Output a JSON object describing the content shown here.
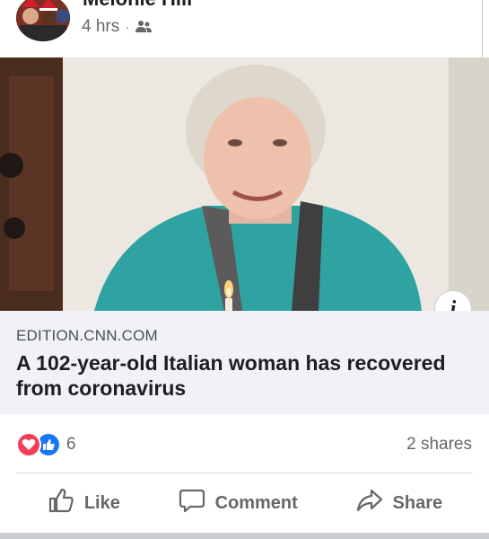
{
  "post": {
    "author": "Melonie Hill",
    "timestamp": "4 hrs",
    "separator": "·",
    "audience_icon": "friends-icon"
  },
  "link": {
    "domain": "EDITION.CNN.COM",
    "headline": "A 102-year-old Italian woman has recovered from coronavirus",
    "info_label": "i"
  },
  "reactions": {
    "icons": [
      "love-reaction-icon",
      "like-reaction-icon"
    ],
    "count": "6",
    "shares": "2 shares"
  },
  "actions": {
    "like": "Like",
    "comment": "Comment",
    "share": "Share"
  },
  "colors": {
    "love": "#f33e58",
    "like": "#1877f2",
    "secondary_text": "#65676b",
    "caption_bg": "#f0f2f5"
  }
}
